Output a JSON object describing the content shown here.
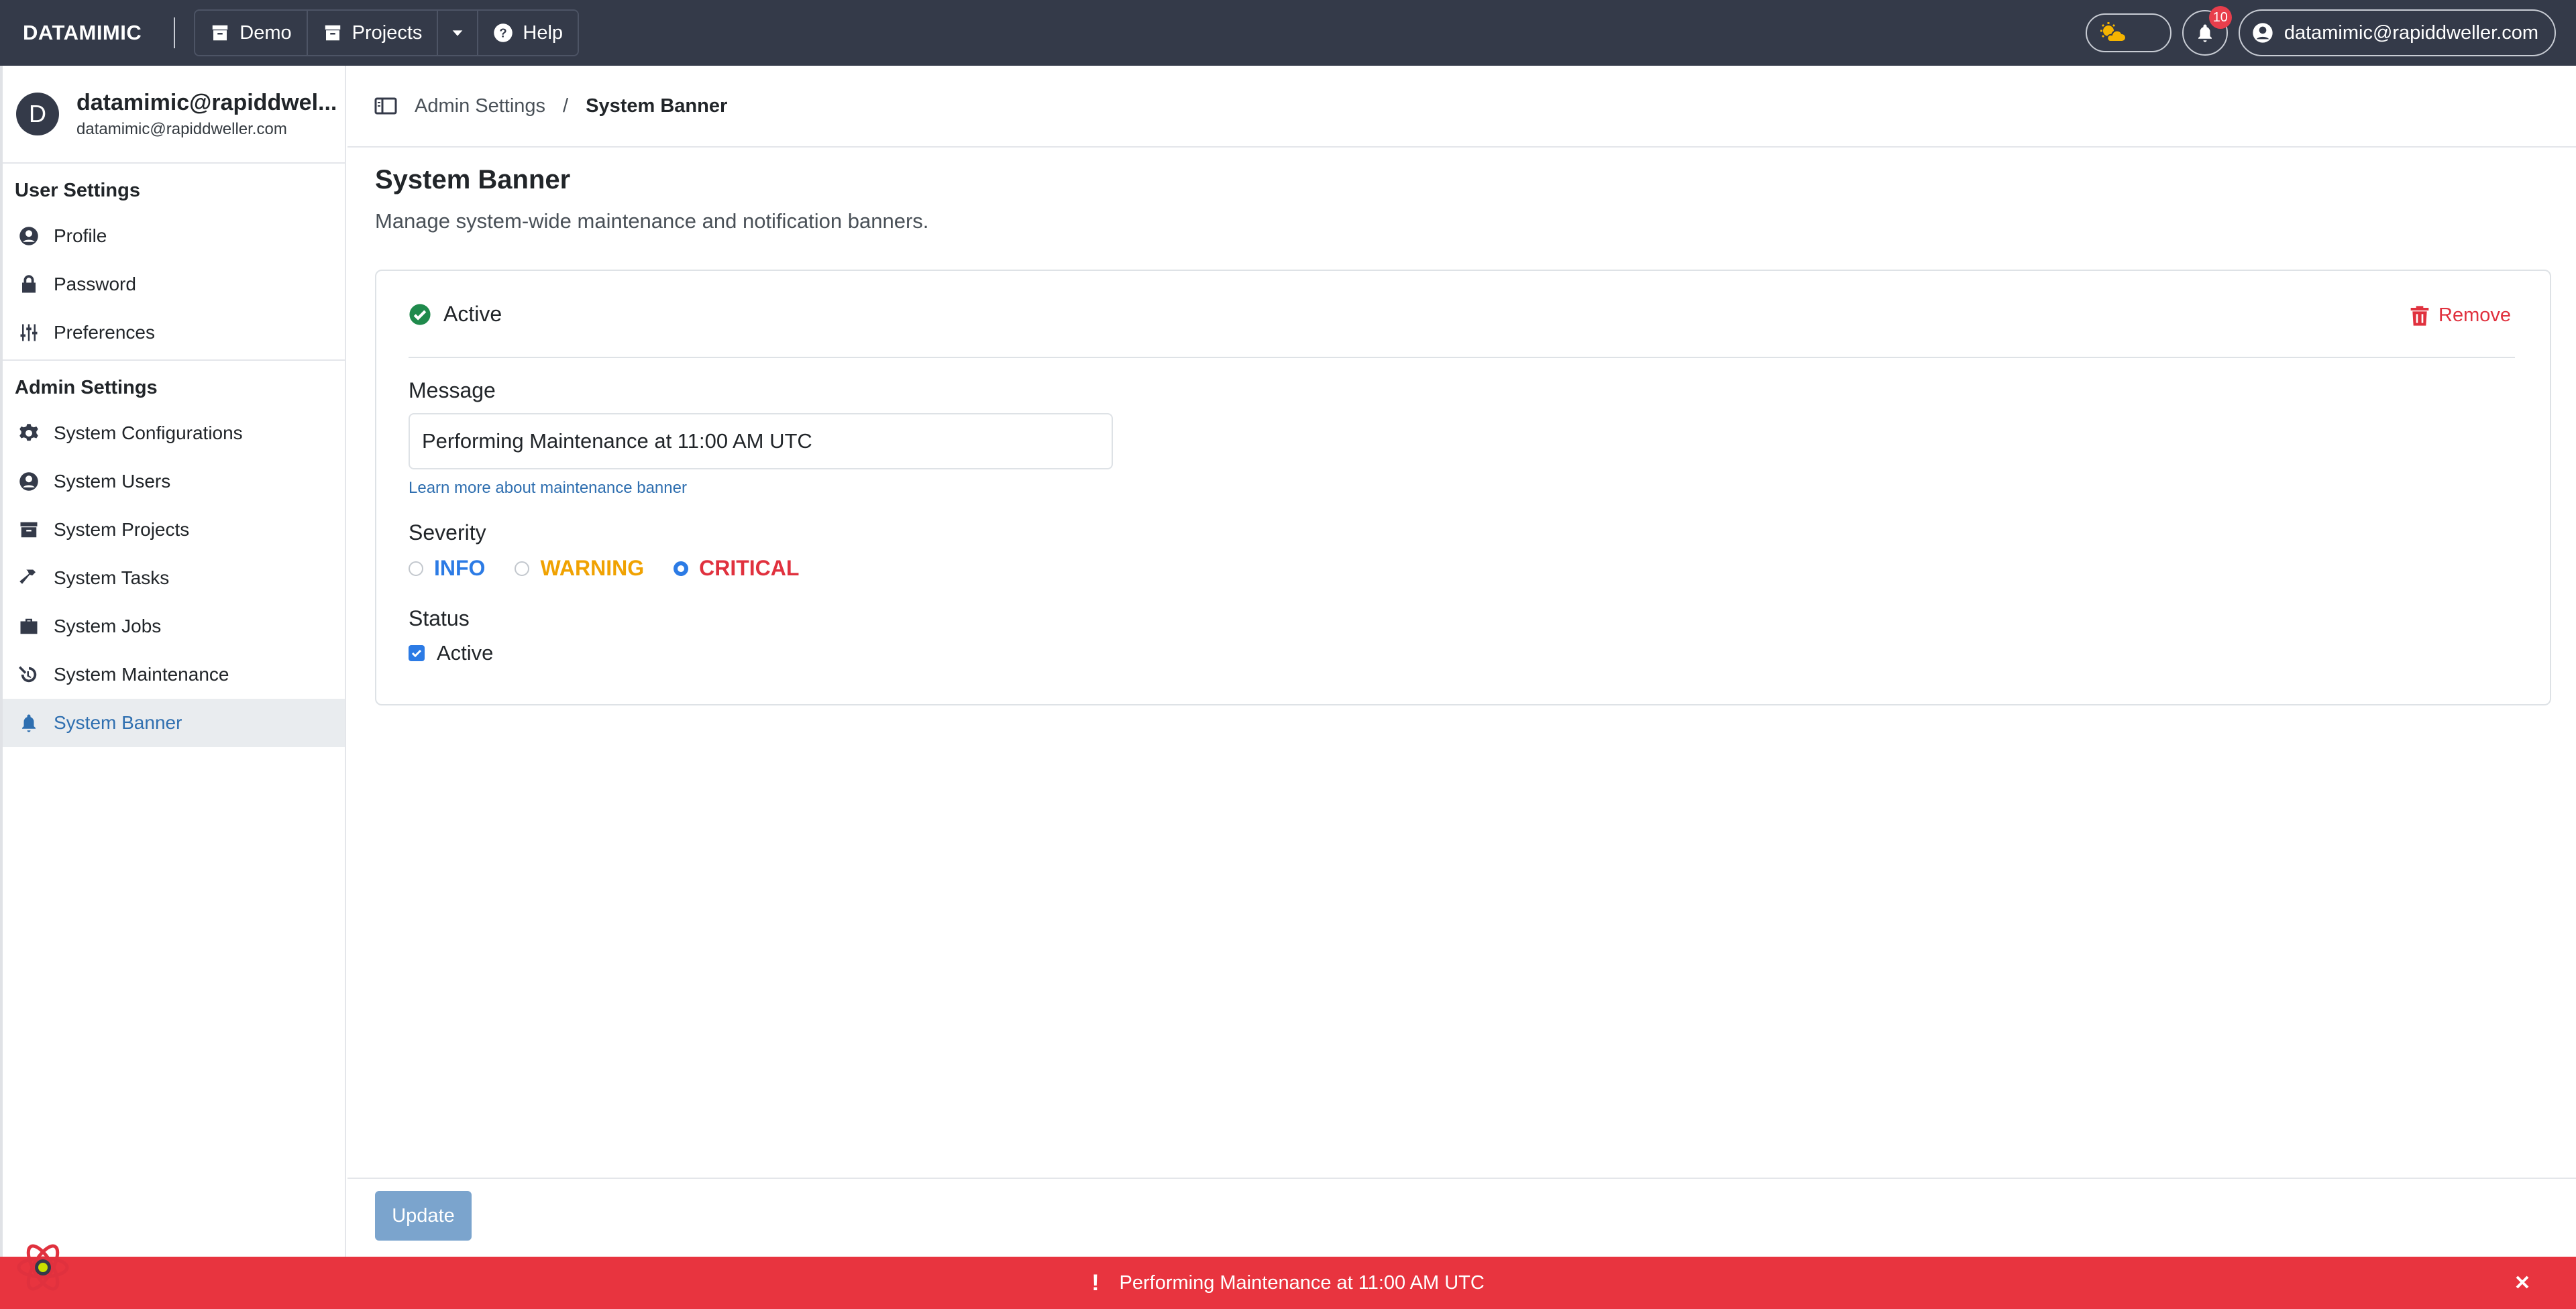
{
  "navbar": {
    "brand": "DATAMIMIC",
    "demo_label": "Demo",
    "projects_label": "Projects",
    "help_label": "Help",
    "notification_count": "10",
    "user_label": "datamimic@rapiddweller.com"
  },
  "sidebar": {
    "profile": {
      "initial": "D",
      "name": "datamimic@rapiddwel...",
      "email": "datamimic@rapiddweller.com"
    },
    "user_settings_title": "User Settings",
    "user_items": [
      {
        "label": "Profile",
        "icon": "user-circle-icon"
      },
      {
        "label": "Password",
        "icon": "lock-icon"
      },
      {
        "label": "Preferences",
        "icon": "sliders-icon"
      }
    ],
    "admin_settings_title": "Admin Settings",
    "admin_items": [
      {
        "label": "System Configurations",
        "icon": "gear-icon"
      },
      {
        "label": "System Users",
        "icon": "user-circle-icon"
      },
      {
        "label": "System Projects",
        "icon": "archive-icon"
      },
      {
        "label": "System Tasks",
        "icon": "hammer-icon"
      },
      {
        "label": "System Jobs",
        "icon": "briefcase-icon"
      },
      {
        "label": "System Maintenance",
        "icon": "maintenance-icon"
      },
      {
        "label": "System Banner",
        "icon": "bell-icon",
        "active": true
      }
    ]
  },
  "breadcrumb": {
    "parent": "Admin Settings",
    "separator": "/",
    "current": "System Banner"
  },
  "page": {
    "title": "System Banner",
    "subtitle": "Manage system-wide maintenance and notification banners."
  },
  "card": {
    "status_label": "Active",
    "remove_label": "Remove",
    "message_label": "Message",
    "message_value": "Performing Maintenance at 11:00 AM UTC",
    "learn_more": "Learn more about maintenance banner",
    "severity_label": "Severity",
    "severity_options": [
      {
        "label": "INFO",
        "color": "#2c7be5",
        "checked": false
      },
      {
        "label": "WARNING",
        "color": "#f0a202",
        "checked": false
      },
      {
        "label": "CRITICAL",
        "color": "#e0313e",
        "checked": true
      }
    ],
    "status_section_label": "Status",
    "active_checkbox_label": "Active",
    "active_checked": true
  },
  "footer": {
    "update_label": "Update"
  },
  "banner": {
    "icon": "!",
    "message": "Performing Maintenance at 11:00 AM UTC"
  },
  "colors": {
    "navbar_bg": "#343a49",
    "banner_bg": "#e8343f",
    "accent": "#2c7be5",
    "active_sidebar_text": "#2f6fb0"
  }
}
